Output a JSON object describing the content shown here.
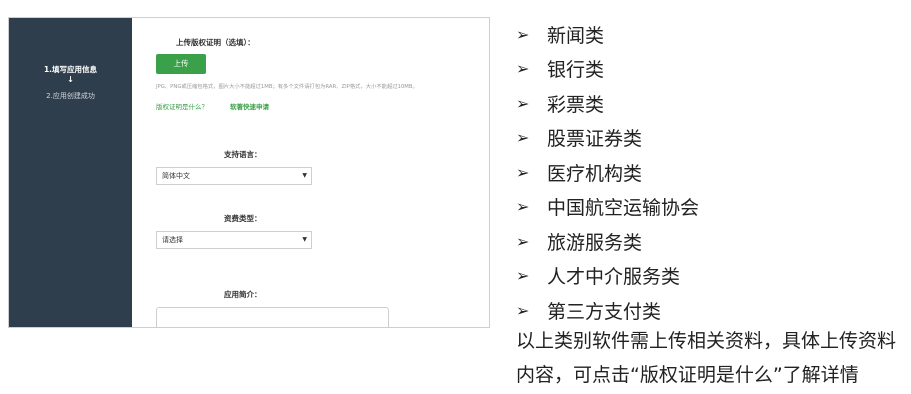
{
  "sidebar": {
    "step1": "1.填写应用信息",
    "arrow": "➜",
    "step2": "2.应用创建成功"
  },
  "form": {
    "copyright_label": "上传版权证明（选填）：",
    "upload_button": "上传",
    "hint": "JPG、PNG或压缩包格式，图片大小不能超过1MB；有多个文件请打包为RAR、ZIP格式，大小不能超过10MB。",
    "link_what": "版权证明是什么？",
    "link_apply": "软著快速申请",
    "language_label": "支持语言：",
    "language_value": "简体中文",
    "fee_label": "资费类型：",
    "fee_value": "请选择",
    "intro_label": "应用简介："
  },
  "categories": [
    "新闻类",
    "银行类",
    "彩票类",
    "股票证券类",
    "医疗机构类",
    "中国航空运输协会",
    "旅游服务类",
    "人才中介服务类",
    "第三方支付类"
  ],
  "bullet_icon": "arrowhead-bullet-icon",
  "bullet_glyph": "➢",
  "description": "以上类别软件需上传相关资料，具体上传资料内容，可点击“版权证明是什么”了解详情",
  "colors": {
    "sidebar": "#2f3e4c",
    "accent_green": "#3aa14a"
  }
}
